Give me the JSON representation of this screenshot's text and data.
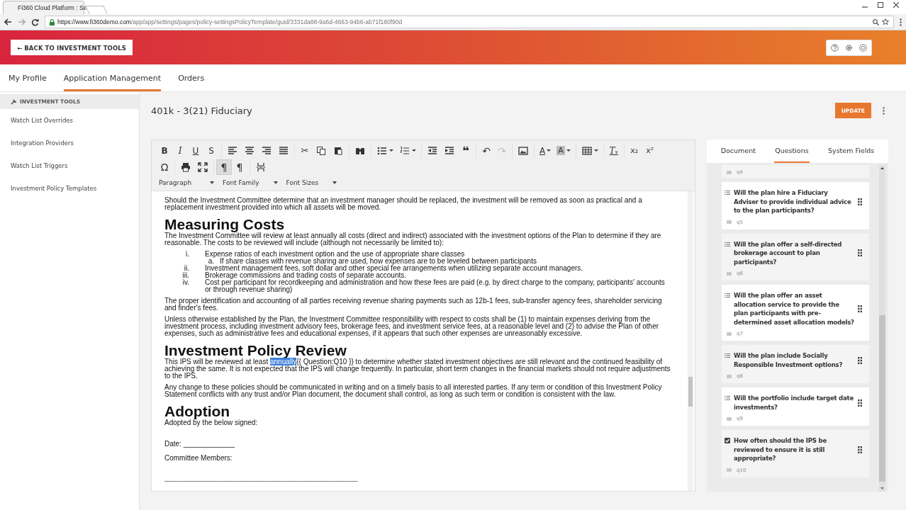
{
  "browser": {
    "tab_title": "Fi360 Cloud Platform : Se",
    "url_host": "https://www.fi360demo.com",
    "url_path": "/app/app/settings/pages/policy-settingsPolicyTemplate/guid/3331da88-9a6d-4663-94b6-ab71f180f90d"
  },
  "header": {
    "back_button": "← BACK TO INVESTMENT TOOLS"
  },
  "nav": [
    {
      "label": "My Profile",
      "selected": false
    },
    {
      "label": "Application Management",
      "selected": true
    },
    {
      "label": "Orders",
      "selected": false
    }
  ],
  "sidebar": {
    "heading": "INVESTMENT TOOLS",
    "items": [
      "Watch List Overrides",
      "Integration Providers",
      "Watch List Triggers",
      "Investment Policy Templates"
    ]
  },
  "page": {
    "title": "401k - 3(21) Fiduciary",
    "update_button": "UPDATE"
  },
  "editor": {
    "toolbar": [
      [
        [
          {
            "kind": "bold",
            "glyph": "B",
            "pressed": false,
            "disabled": false,
            "dropdown": false
          },
          {
            "kind": "italic",
            "glyph": "I",
            "pressed": false,
            "disabled": false,
            "dropdown": false
          },
          {
            "kind": "underline",
            "glyph": "U",
            "pressed": false,
            "disabled": false,
            "dropdown": false
          },
          {
            "kind": "strikethrough",
            "glyph": "S",
            "pressed": false,
            "disabled": false,
            "dropdown": false
          }
        ],
        [
          {
            "kind": "align-left",
            "pressed": false,
            "disabled": false,
            "dropdown": false
          },
          {
            "kind": "align-center",
            "pressed": false,
            "disabled": false,
            "dropdown": false
          },
          {
            "kind": "align-right",
            "pressed": false,
            "disabled": false,
            "dropdown": false
          },
          {
            "kind": "justify",
            "pressed": false,
            "disabled": false,
            "dropdown": false
          }
        ],
        [
          {
            "kind": "cut",
            "glyph": "✂",
            "pressed": false,
            "disabled": false,
            "dropdown": false
          },
          {
            "kind": "copy",
            "pressed": false,
            "disabled": false,
            "dropdown": false
          },
          {
            "kind": "paste",
            "pressed": false,
            "disabled": false,
            "dropdown": false
          }
        ],
        [
          {
            "kind": "find",
            "pressed": false,
            "disabled": false,
            "dropdown": false
          }
        ],
        [
          {
            "kind": "bullet-list",
            "pressed": false,
            "disabled": false,
            "dropdown": true
          },
          {
            "kind": "numbered-list",
            "pressed": false,
            "disabled": false,
            "dropdown": true
          }
        ],
        [
          {
            "kind": "outdent",
            "pressed": false,
            "disabled": false,
            "dropdown": false
          },
          {
            "kind": "indent",
            "pressed": false,
            "disabled": false,
            "dropdown": false
          },
          {
            "kind": "blockquote",
            "glyph": "❝",
            "pressed": false,
            "disabled": false,
            "dropdown": false
          }
        ],
        [
          {
            "kind": "undo",
            "glyph": "↶",
            "pressed": false,
            "disabled": false,
            "dropdown": false
          },
          {
            "kind": "redo",
            "glyph": "↷",
            "pressed": false,
            "disabled": true,
            "dropdown": false
          }
        ],
        [
          {
            "kind": "image",
            "pressed": false,
            "disabled": false,
            "dropdown": false
          }
        ],
        [
          {
            "kind": "text-color",
            "glyph": "A",
            "pressed": false,
            "disabled": false,
            "dropdown": true
          },
          {
            "kind": "highlight",
            "glyph": "A",
            "pressed": false,
            "disabled": false,
            "dropdown": true
          }
        ],
        [
          {
            "kind": "table",
            "pressed": false,
            "disabled": false,
            "dropdown": true
          }
        ],
        [
          {
            "kind": "clear-format",
            "glyph": "Tₓ",
            "pressed": false,
            "disabled": false,
            "dropdown": false
          }
        ],
        [
          {
            "kind": "subscript",
            "glyph": "x₂",
            "pressed": false,
            "disabled": false,
            "dropdown": false
          },
          {
            "kind": "superscript",
            "glyph": "x²",
            "pressed": false,
            "disabled": false,
            "dropdown": false
          }
        ]
      ],
      [
        [
          {
            "kind": "special-character",
            "glyph": "Ω",
            "pressed": false,
            "disabled": false,
            "dropdown": false
          }
        ],
        [
          {
            "kind": "print",
            "pressed": false,
            "disabled": false,
            "dropdown": false
          },
          {
            "kind": "fullscreen",
            "pressed": false,
            "disabled": false,
            "dropdown": false
          }
        ],
        [
          {
            "kind": "left-to-right",
            "glyph": "¶",
            "pressed": true,
            "disabled": false,
            "dropdown": false
          },
          {
            "kind": "right-to-left",
            "glyph": "¶",
            "pressed": false,
            "disabled": false,
            "dropdown": false
          }
        ],
        [
          {
            "kind": "page-break",
            "pressed": false,
            "disabled": false,
            "dropdown": false
          }
        ]
      ]
    ],
    "format_menus": [
      "Paragraph",
      "Font Family",
      "Font Sizes"
    ],
    "document": [
      {
        "kind": "p",
        "text": "Should the Investment Committee determine that an investment manager should be replaced, the investment will be removed as soon as practical and a replacement investment provided into which all assets will be moved."
      },
      {
        "kind": "h1",
        "text": "Measuring Costs"
      },
      {
        "kind": "p",
        "text": "The Investment Committee will review at least annually all costs (direct and indirect) associated with the investment options of the Plan to determine if they are reasonable. The costs to be reviewed will include (although not necessarily be limited to):"
      },
      {
        "kind": "list",
        "items": [
          {
            "marker": "i.",
            "text": "Expense ratios of each investment option and the use of appropriate share classes",
            "children": [
              {
                "marker": "a.",
                "text": "If share classes with revenue sharing are used, how expenses are to be leveled between participants"
              }
            ]
          },
          {
            "marker": "ii.",
            "text": "Investment management fees, soft dollar and other special fee arrangements when utilizing separate account managers."
          },
          {
            "marker": "iii.",
            "text": "Brokerage commissions and trading costs of separate accounts."
          },
          {
            "marker": "iv.",
            "text": "Cost per participant for recordkeeping and administration and how these fees are paid (e.g. by direct charge to the company, participants' accounts or through revenue sharing)"
          }
        ]
      },
      {
        "kind": "p",
        "text": "The proper identification and accounting of all parties receiving revenue sharing payments such as 12b-1 fees, sub-transfer agency fees, shareholder servicing and finder's fees."
      },
      {
        "kind": "p",
        "text": "Unless otherwise established by the Plan, the Investment Committee responsibility with respect to costs shall be (1) to maintain expenses deriving from the investment process, including investment advisory fees, brokerage fees, and investment service fees, at a reasonable level and (2) to advise the Plan of other expenses, such as administrative fees and educational expenses, if it appears that such other expenses are unreasonably excessive."
      },
      {
        "kind": "h1",
        "text": "Investment Policy Review"
      },
      {
        "kind": "p",
        "segments": [
          {
            "text": "This IPS will be reviewed at least ",
            "selected": false
          },
          {
            "text": "annually",
            "selected": true
          },
          {
            "text": "{{ Question:Q10 }} to determine whether stated investment objectives are still relevant and the continued feasibility of achieving the same. It is not expected that the IPS will change frequently. In particular, short term changes in the financial markets should not require adjustments to the IPS.",
            "selected": false
          }
        ]
      },
      {
        "kind": "p",
        "text": "Any change to these policies should be communicated in writing and on a timely basis to all interested parties. If any term or condition of this Investment Policy Statement conflicts with any trust and/or Plan document, the document shall control, as long as such term or condition is consistent with the law."
      },
      {
        "kind": "h1",
        "text": "Adoption"
      },
      {
        "kind": "p",
        "text": "Adopted by the below signed:"
      },
      {
        "kind": "field",
        "text": "Date: _____________"
      },
      {
        "kind": "field",
        "text": "Committee Members:"
      },
      {
        "kind": "signature",
        "text": "_________________________________________________"
      }
    ]
  },
  "questions_panel": {
    "tabs": [
      {
        "label": "Document",
        "selected": false
      },
      {
        "label": "Questions",
        "selected": true
      },
      {
        "label": "System Fields",
        "selected": false
      }
    ],
    "cut_off_item": {
      "id": "q4"
    },
    "questions": [
      {
        "text": "Will the plan hire a Fiduciary Adviser to provide individual advice to the plan participants?",
        "id": "q5",
        "checked": false
      },
      {
        "text": "Will the plan offer a self-directed brokerage account to plan participants?",
        "id": "q6",
        "checked": false
      },
      {
        "text": "Will the plan offer an asset allocation service to provide the plan participants with pre-determined asset allocation models?",
        "id": "q7",
        "checked": false
      },
      {
        "text": "Will the plan include Socially Responsible Investment options?",
        "id": "q8",
        "checked": false
      },
      {
        "text": "Will the portfolio include target date investments?",
        "id": "q9",
        "checked": false
      },
      {
        "text": "How often should the IPS be reviewed to ensure it is still appropriate?",
        "id": "q10",
        "checked": true
      }
    ]
  }
}
